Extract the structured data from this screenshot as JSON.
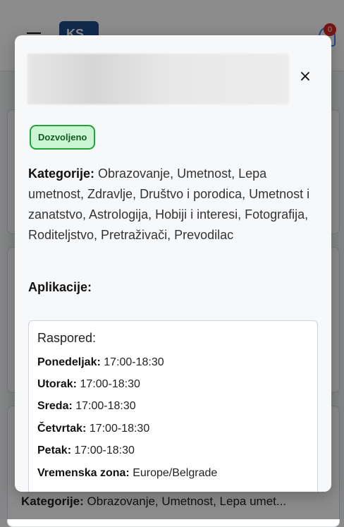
{
  "background": {
    "cart_count": "0",
    "logo_text": "KS",
    "card_categories_label": "Kategorije:",
    "card_categories_value": "Obrazovanje, Umetnost, Lepa umet..."
  },
  "modal": {
    "badge": "Dozvoljeno",
    "close_label": "×",
    "categories_label": "Kategorije:",
    "categories_value": "Obrazovanje, Umetnost, Lepa umetnost, Zdravlje, Društvo i porodica, Umetnost i zanatstvo, Astrologija, Hobiji i interesi, Fotografija, Roditeljstvo, Pretraživači, Prevodilac",
    "apps_label": "Aplikacije:",
    "schedule": {
      "title": "Raspored:",
      "rows": [
        {
          "label": "Ponedeljak:",
          "value": "17:00-18:30"
        },
        {
          "label": "Utorak:",
          "value": "17:00-18:30"
        },
        {
          "label": "Sreda:",
          "value": "17:00-18:30"
        },
        {
          "label": "Četvrtak:",
          "value": "17:00-18:30"
        },
        {
          "label": "Petak:",
          "value": "17:00-18:30"
        },
        {
          "label": "Vremenska zona:",
          "value": "Europe/Belgrade"
        }
      ]
    }
  }
}
